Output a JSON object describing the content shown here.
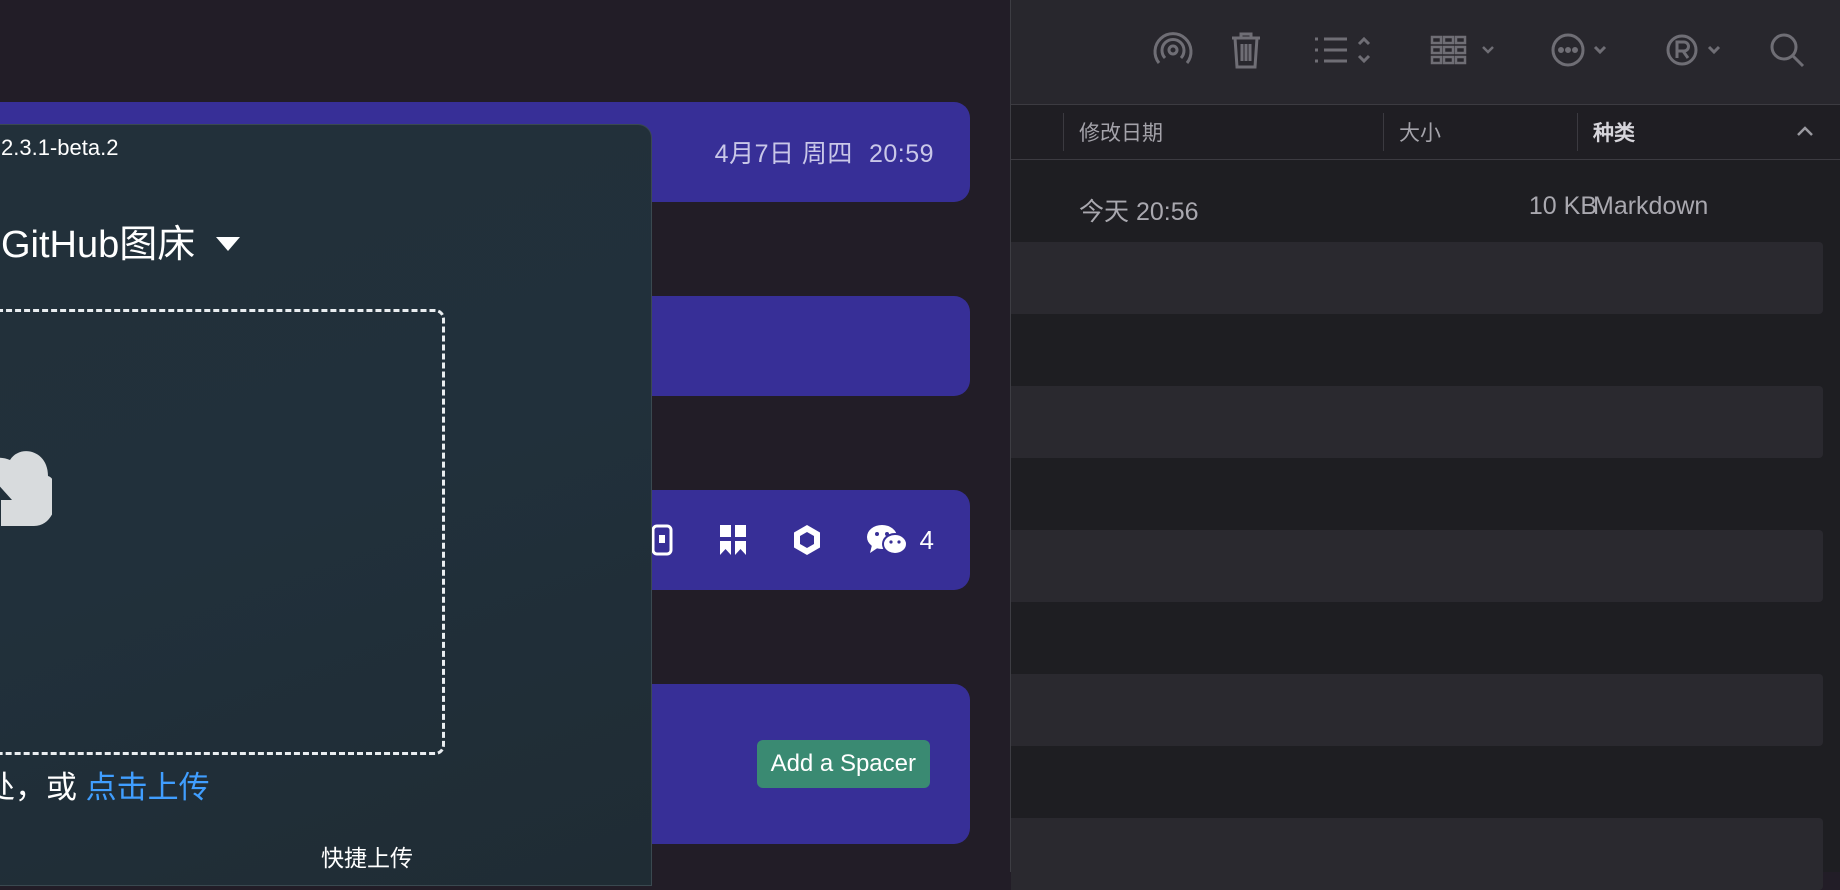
{
  "background_app": {
    "date": "4月7日 周四",
    "time": "20:59",
    "wechat_count": "4",
    "spacer_button": "Add a Spacer",
    "icons": [
      "phone-icon",
      "bookmark-icon",
      "hexagon-icon",
      "wechat-icon"
    ]
  },
  "picgo": {
    "version": "2.3.1-beta.2",
    "picbed_name": "GitHub图床",
    "drop_text_prefix": "处，或 ",
    "drop_text_link": "点击上传",
    "quick_upload": "快捷上传"
  },
  "finder": {
    "toolbar_icons": [
      "airdrop-icon",
      "trash-icon",
      "list-view-icon",
      "grid-view-icon",
      "more-icon",
      "tag-icon",
      "search-icon"
    ],
    "columns": {
      "modified": "修改日期",
      "size": "大小",
      "kind": "种类"
    },
    "files": [
      {
        "modified": "今天 20:56",
        "size": "10 KB",
        "kind": "Markdown"
      }
    ]
  },
  "colors": {
    "bar_blue": "#372f97",
    "accent_link": "#409eff",
    "spacer_green": "#3a8a72"
  }
}
